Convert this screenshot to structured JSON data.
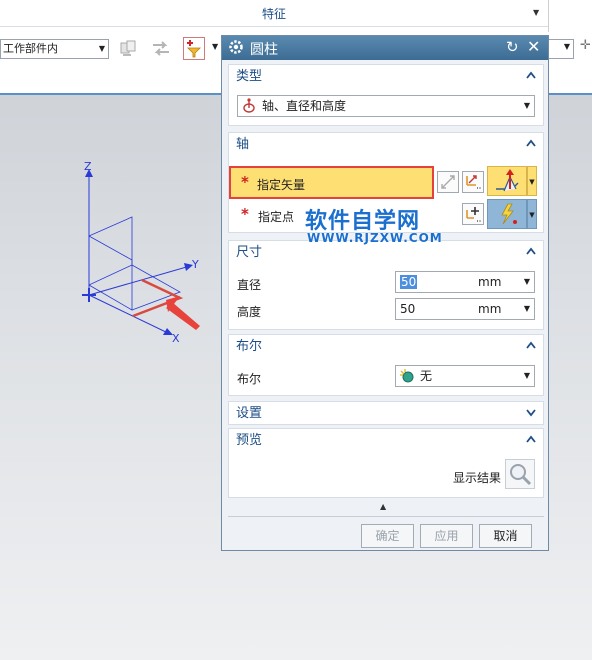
{
  "ribbon": {
    "group_title": "特征",
    "scope_value": "工作部件内"
  },
  "scene": {
    "axis_z": "Z",
    "axis_y": "Y",
    "axis_x": "X"
  },
  "dialog": {
    "title": "圆柱",
    "type": {
      "header": "类型",
      "value": "轴、直径和高度"
    },
    "axis": {
      "header": "轴",
      "vector_label": "指定矢量",
      "point_label": "指定点"
    },
    "dimensions": {
      "header": "尺寸",
      "diameter_label": "直径",
      "diameter_value": "50",
      "diameter_unit": "mm",
      "height_label": "高度",
      "height_value": "50",
      "height_unit": "mm"
    },
    "boolean": {
      "header": "布尔",
      "label": "布尔",
      "value": "无"
    },
    "settings": {
      "header": "设置"
    },
    "preview": {
      "header": "预览",
      "show_result_label": "显示结果"
    },
    "buttons": {
      "ok": "确定",
      "apply": "应用",
      "cancel": "取消"
    }
  },
  "watermark": {
    "title": "软件自学网",
    "subtitle": "WWW.RJZXW.COM"
  },
  "colors": {
    "title_bar": "#3c6c93",
    "section_header_text": "#1d4e86",
    "highlight_fill": "#fddf73",
    "highlight_border": "#e5413d",
    "watermark": "#1a6fcf",
    "axis_lines": "#2a3ad6"
  }
}
